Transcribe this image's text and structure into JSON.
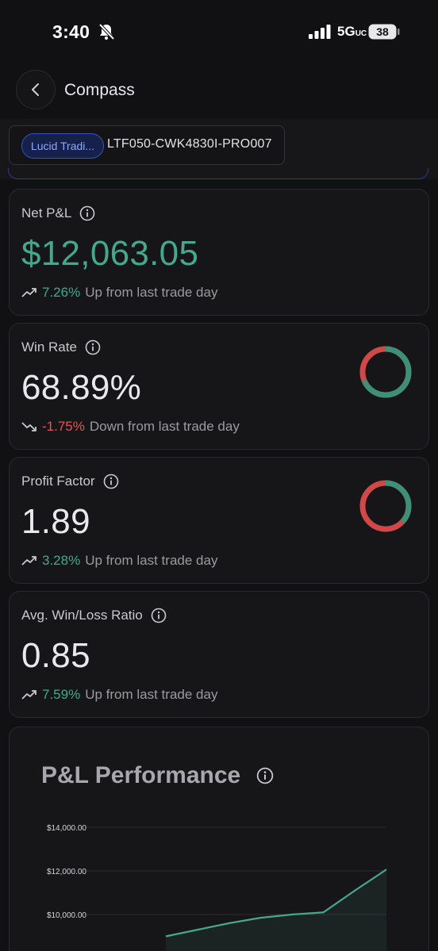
{
  "status_bar": {
    "time": "3:40",
    "network": "5G",
    "network_suffix": "UC",
    "battery": "38"
  },
  "nav": {
    "title": "Compass"
  },
  "account": {
    "chip_label": "Lucid Tradi...",
    "account_id": "LTF050-CWK4830I-PRO007"
  },
  "metrics": [
    {
      "label": "Net P&L",
      "value": "$12,063.05",
      "change_pct": "7.26%",
      "change_text": "Up from last trade day",
      "direction": "up",
      "value_color": "#45a88a"
    },
    {
      "label": "Win Rate",
      "value": "68.89%",
      "change_pct": "-1.75%",
      "change_text": "Down from last trade day",
      "direction": "down",
      "donut_fraction": 0.6889
    },
    {
      "label": "Profit Factor",
      "value": "1.89",
      "change_pct": "3.28%",
      "change_text": "Up from last trade day",
      "direction": "up",
      "donut_fraction": 0.37
    },
    {
      "label": "Avg. Win/Loss Ratio",
      "value": "0.85",
      "change_pct": "7.59%",
      "change_text": "Up from last trade day",
      "direction": "up"
    }
  ],
  "colors": {
    "positive": "#45a88a",
    "negative": "#e05555",
    "accent": "#3553b8"
  },
  "chart": {
    "title": "P&L Performance"
  },
  "chart_data": {
    "type": "area",
    "title": "P&L Performance",
    "ytick_labels": [
      "$14,000.00",
      "$12,000.00",
      "$10,000.00"
    ],
    "ylim": [
      8000,
      14500
    ],
    "x": [
      0,
      1,
      2,
      3,
      4,
      5,
      6,
      7
    ],
    "series": [
      {
        "values": [
          9000,
          9300,
          9600,
          9850,
          10000,
          10100,
          11100,
          12063.05
        ]
      }
    ],
    "grid": true
  }
}
